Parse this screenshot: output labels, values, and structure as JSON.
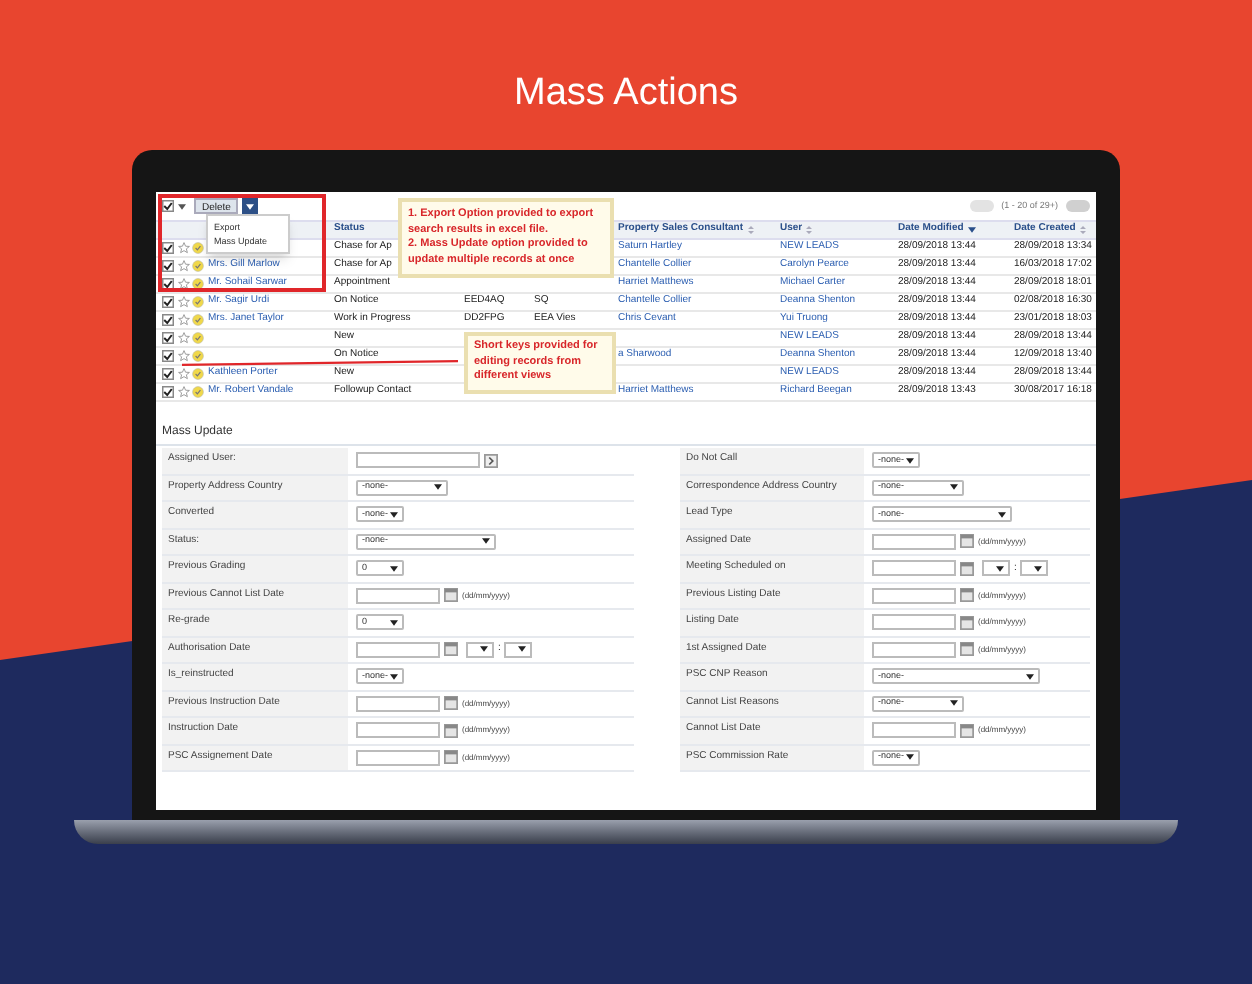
{
  "title": "Mass Actions",
  "toolbar": {
    "select_all": {
      "checked": true
    },
    "action_button": "Delete",
    "menu": [
      "Export",
      "Mass Update"
    ],
    "pager": "(1 - 20 of 29+)"
  },
  "table": {
    "headers": {
      "status": {
        "label": "Status"
      },
      "consultant": {
        "label": "Property Sales Consultant",
        "sorted": false
      },
      "user": {
        "label": "User",
        "sorted": false
      },
      "date_modified": {
        "label": "Date Modified",
        "sorted": true
      },
      "date_created": {
        "label": "Date Created",
        "sorted": false
      }
    },
    "rows": [
      {
        "checked": true,
        "status": "Chase for Ap",
        "consultant": "Saturn Hartley",
        "user": "NEW LEADS",
        "date_modified": "28/09/2018 13:44",
        "date_created": "28/09/2018 13:34"
      },
      {
        "checked": true,
        "name": "Mrs. Gill Marlow",
        "status": "Chase for Ap",
        "consultant": "Chantelle Collier",
        "user": "Carolyn Pearce",
        "date_modified": "28/09/2018 13:44",
        "date_created": "16/03/2018 17:02"
      },
      {
        "checked": true,
        "name": "Mr. Sohail Sarwar",
        "status": "Appointment",
        "consultant": "Harriet Matthews",
        "user": "Michael Carter",
        "date_modified": "28/09/2018 13:44",
        "date_created": "28/09/2018 18:01"
      },
      {
        "checked": true,
        "name": "Mr. Sagir Urdi",
        "status": "On Notice",
        "column_3": "EED4AQ",
        "column_4": "SQ",
        "consultant": "Chantelle Collier",
        "user": "Deanna Shenton",
        "date_modified": "28/09/2018 13:44",
        "date_created": "02/08/2018 16:30"
      },
      {
        "checked": true,
        "name": "Mrs. Janet Taylor",
        "status": "Work in Progress",
        "column_3": "DD2FPG",
        "column_4": "EEA Vies",
        "consultant": "Chris Cevant",
        "user": "Yui Truong",
        "date_modified": "28/09/2018 13:44",
        "date_created": "23/01/2018 18:03"
      },
      {
        "checked": true,
        "status": "New",
        "user": "NEW LEADS",
        "date_modified": "28/09/2018 13:44",
        "date_created": "28/09/2018 13:44"
      },
      {
        "checked": true,
        "status": "On Notice",
        "consultant": "a Sharwood",
        "user": "Deanna Shenton",
        "date_modified": "28/09/2018 13:44",
        "date_created": "12/09/2018 13:40"
      },
      {
        "checked": true,
        "name": "Kathleen Porter",
        "status": "New",
        "user": "NEW LEADS",
        "date_modified": "28/09/2018 13:44",
        "date_created": "28/09/2018 13:44"
      },
      {
        "checked": true,
        "name": "Mr. Robert Vandale",
        "status": "Followup Contact",
        "consultant": "Harriet Matthews",
        "user": "Richard Beegan",
        "date_modified": "28/09/2018 13:43",
        "date_created": "30/08/2017 16:18"
      }
    ]
  },
  "callouts": [
    "1. Export Option provided to export search results in excel file.\n2. Mass Update option provided to update multiple records at once",
    "Short keys provided for editing records from different views"
  ],
  "mass_update": {
    "title": "Mass Update",
    "columns": [
      [
        {
          "label": "Assigned User:",
          "kind": "lookup"
        },
        {
          "label": "Property Address Country",
          "kind": "select",
          "value": "-none-"
        },
        {
          "label": "Converted",
          "kind": "select",
          "value": "-none-"
        },
        {
          "label": "Status:",
          "kind": "select",
          "value": "-none-"
        },
        {
          "label": "Previous Grading",
          "kind": "select",
          "value": "0"
        },
        {
          "label": "Previous Cannot List Date",
          "kind": "date",
          "hint": "(dd/mm/yyyy)"
        },
        {
          "label": "Re-grade",
          "kind": "select",
          "value": "0"
        },
        {
          "label": "Authorisation Date",
          "kind": "datetime",
          "separator": ":"
        },
        {
          "label": "Is_reinstructed",
          "kind": "select",
          "value": "-none-"
        },
        {
          "label": "Previous Instruction Date",
          "kind": "date",
          "hint": "(dd/mm/yyyy)"
        },
        {
          "label": "Instruction Date",
          "kind": "date",
          "hint": "(dd/mm/yyyy)"
        },
        {
          "label": "PSC Assignement Date",
          "kind": "date",
          "hint": "(dd/mm/yyyy)"
        }
      ],
      [
        {
          "label": "Do Not Call",
          "kind": "select",
          "value": "-none-"
        },
        {
          "label": "Correspondence Address Country",
          "kind": "select",
          "value": "-none-"
        },
        {
          "label": "Lead Type",
          "kind": "select",
          "value": "-none-"
        },
        {
          "label": "Assigned Date",
          "kind": "date",
          "hint": "(dd/mm/yyyy)"
        },
        {
          "label": "Meeting Scheduled on",
          "kind": "datetime",
          "separator": ":"
        },
        {
          "label": "Previous Listing Date",
          "kind": "date",
          "hint": "(dd/mm/yyyy)"
        },
        {
          "label": "Listing Date",
          "kind": "date",
          "hint": "(dd/mm/yyyy)"
        },
        {
          "label": "1st Assigned Date",
          "kind": "date",
          "hint": "(dd/mm/yyyy)"
        },
        {
          "label": "PSC CNP Reason",
          "kind": "select",
          "value": "-none-"
        },
        {
          "label": "Cannot List Reasons",
          "kind": "select",
          "value": "-none-"
        },
        {
          "label": "Cannot List Date",
          "kind": "date",
          "hint": "(dd/mm/yyyy)"
        },
        {
          "label": "PSC Commission Rate",
          "kind": "select",
          "value": "-none-"
        }
      ]
    ]
  }
}
